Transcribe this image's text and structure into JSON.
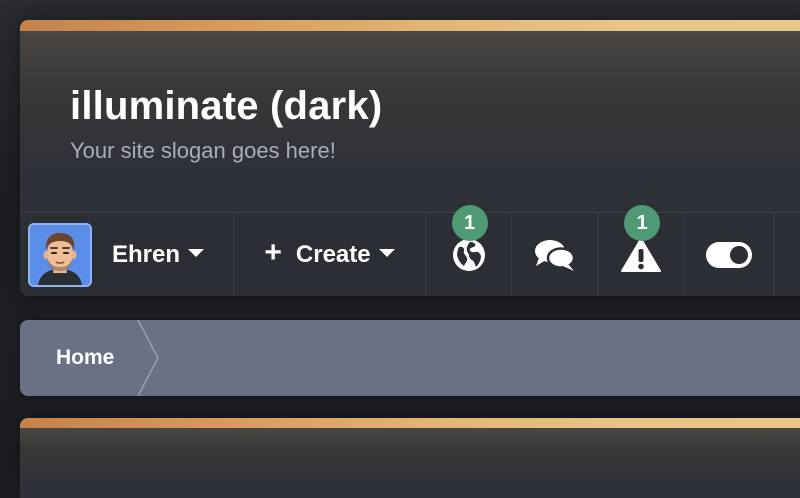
{
  "site": {
    "title": "illuminate (dark)",
    "slogan": "Your site slogan goes here!"
  },
  "nav": {
    "user": {
      "name": "Ehren",
      "avatar_icon": "memoji-avatar"
    },
    "create": {
      "label": "Create",
      "icon": "plus-icon"
    },
    "whats_new": {
      "icon": "globe-icon",
      "badge": "1"
    },
    "conversations": {
      "icon": "chat-bubbles-icon"
    },
    "alerts": {
      "icon": "warning-icon",
      "badge": "1"
    },
    "style_toggle": {
      "icon": "toggle-icon"
    }
  },
  "breadcrumb": {
    "items": [
      {
        "label": "Home"
      }
    ]
  },
  "colors": {
    "accent_gradient": [
      "#c7814b",
      "#e8c98a"
    ],
    "badge": "#4f9a74",
    "breadcrumb_bg": "#6b7184",
    "panel_bg": "#2e3138",
    "avatar_bg": "#5b8ee8"
  }
}
